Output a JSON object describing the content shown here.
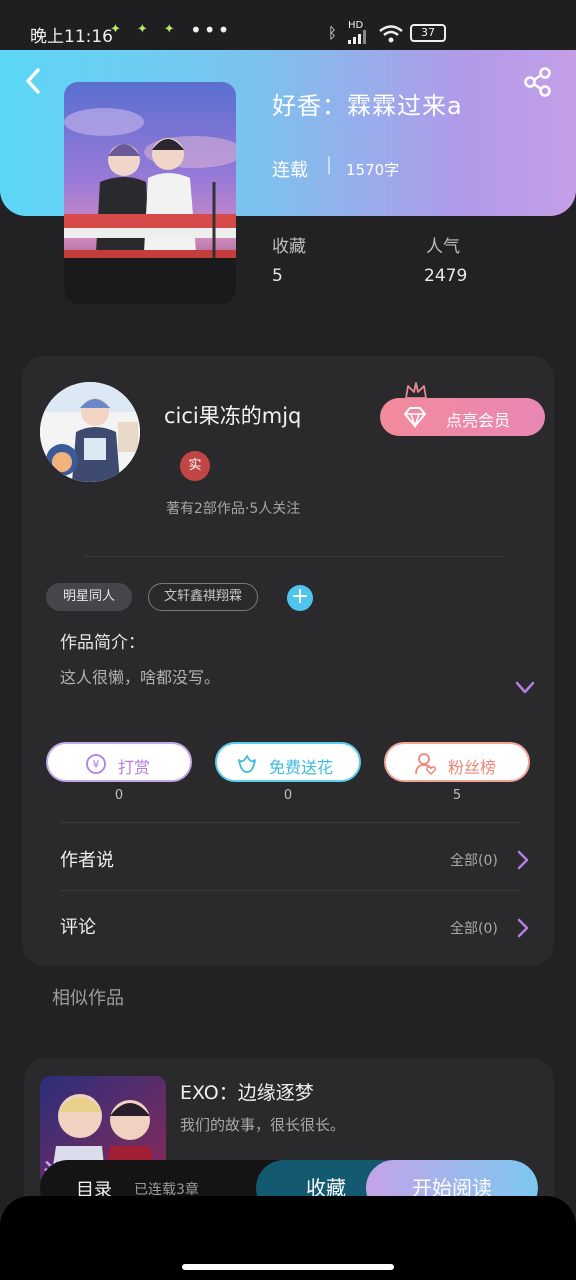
{
  "status_bar": {
    "time": "晚上11:16",
    "more": "•••",
    "hd_label": "HD",
    "battery": "37"
  },
  "header": {
    "title": "好香：霖霖过来a",
    "status": "连载",
    "separator": "|",
    "word_count": "1570字"
  },
  "stats": {
    "favorites_label": "收藏",
    "favorites_value": "5",
    "popularity_label": "人气",
    "popularity_value": "2479"
  },
  "author": {
    "name": "cici果冻的mjq",
    "badge": "实",
    "meta": "著有2部作品·5人关注",
    "vip_button": "点亮会员"
  },
  "tags": [
    "明星同人",
    "文轩鑫祺翔霖"
  ],
  "intro": {
    "title": "作品简介：",
    "text": "这人很懒，啥都没写。"
  },
  "actions": [
    {
      "label": "打赏",
      "count": "0",
      "color": "#b27fe0"
    },
    {
      "label": "免费送花",
      "count": "0",
      "color": "#3dbbe0"
    },
    {
      "label": "粉丝榜",
      "count": "5",
      "color": "#f0867a"
    }
  ],
  "rows": {
    "author_says": "作者说",
    "author_says_right": "全部(0)",
    "comments": "评论",
    "comments_right": "全部(0)"
  },
  "similar": {
    "section_title": "相似作品",
    "title": "EXO：边缘逐梦",
    "desc": "我们的故事，很长很长。"
  },
  "bottom_bar": {
    "menu": "目录",
    "chapters": "已连载3章",
    "collect": "收藏",
    "read": "开始阅读"
  },
  "colors": {
    "header_start": "#5cd7f6",
    "header_end": "#c49fe7",
    "background": "#222224",
    "accent_purple": "#b27fe0",
    "accent_cyan": "#3dbbe0",
    "accent_coral": "#f0867a"
  }
}
